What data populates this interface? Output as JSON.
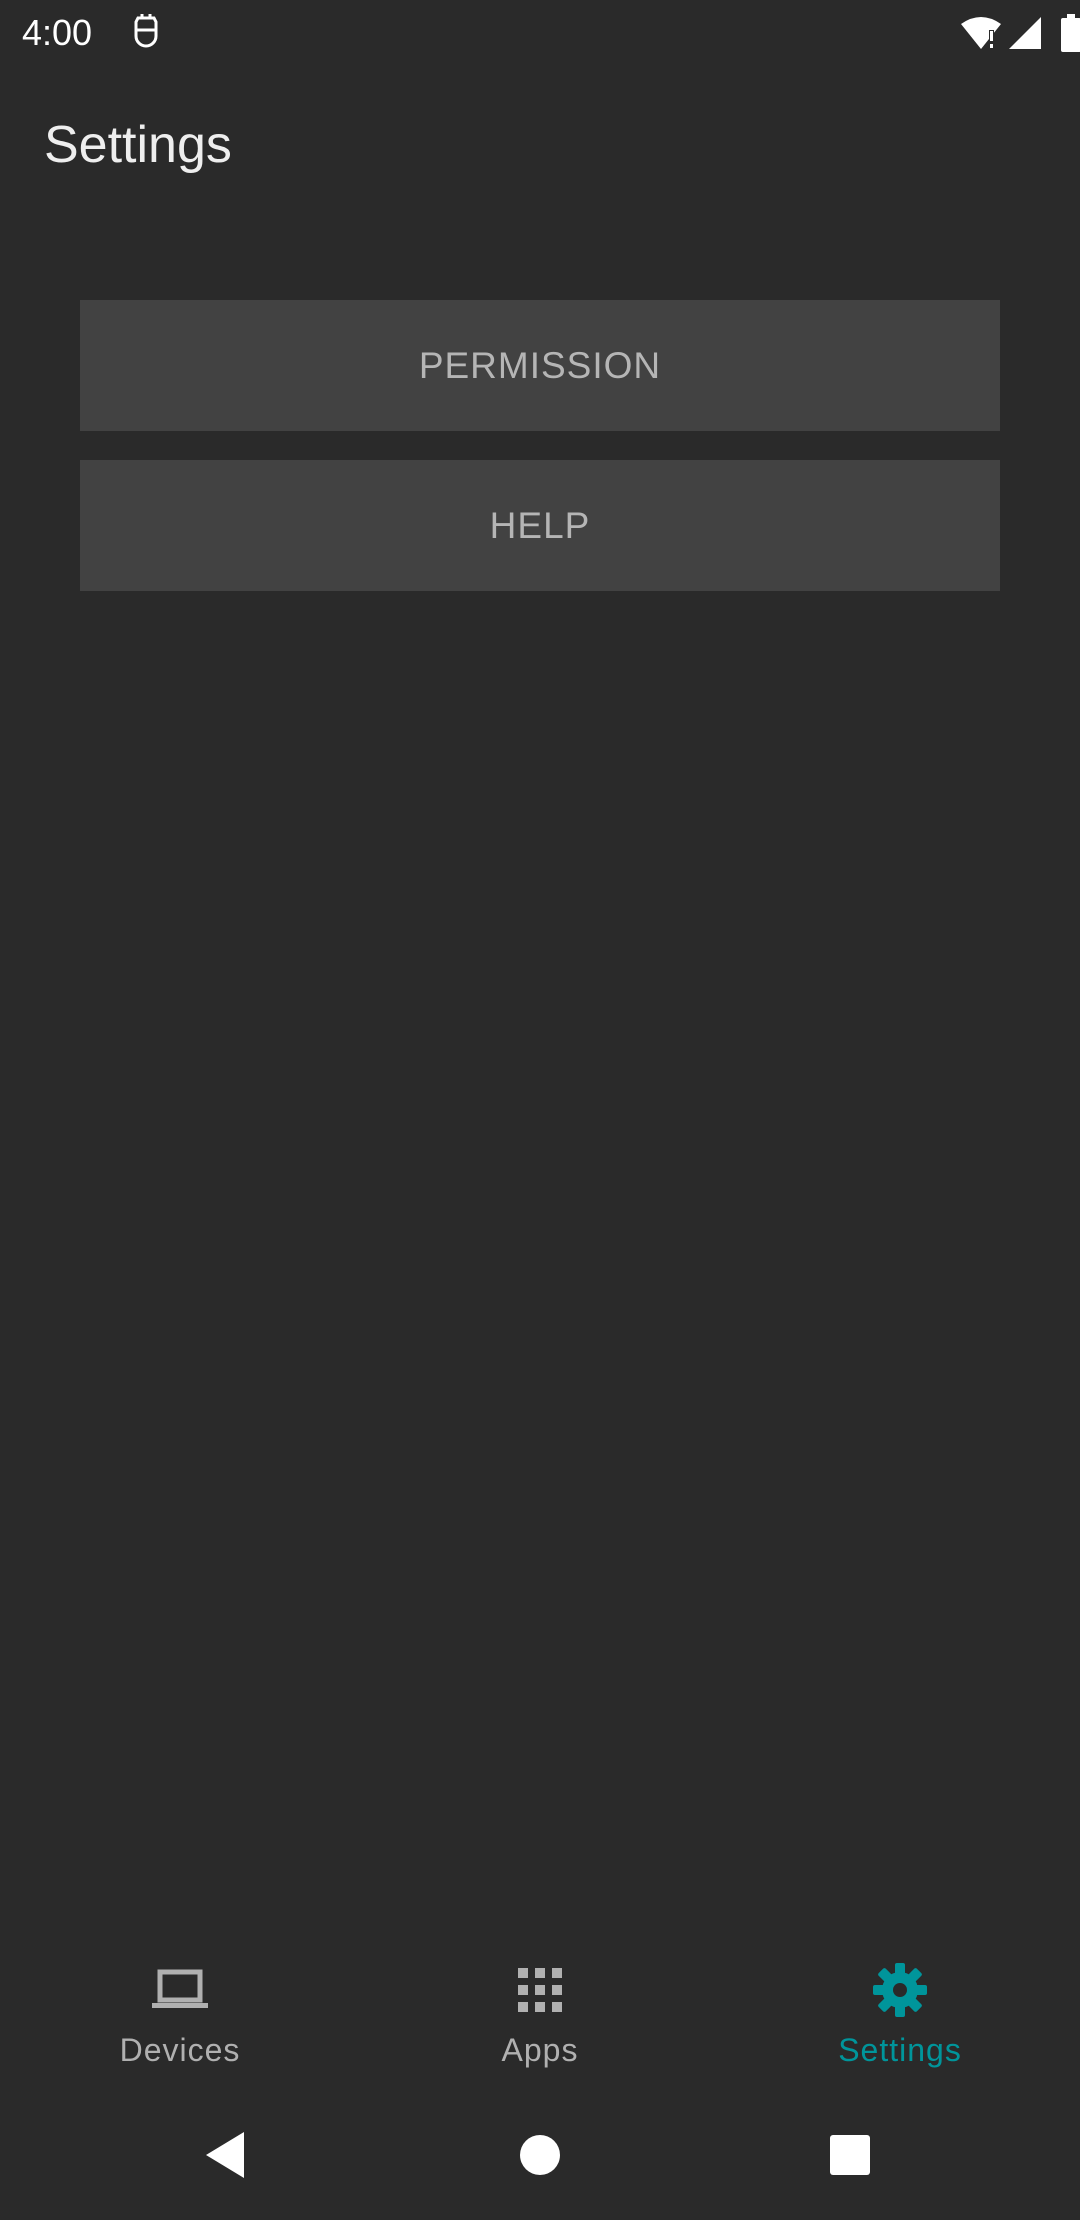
{
  "status_bar": {
    "time": "4:00",
    "icons": [
      "notification-app-icon",
      "wifi-alert-icon",
      "cell-signal-icon",
      "battery-icon"
    ]
  },
  "header": {
    "title": "Settings"
  },
  "main": {
    "buttons": [
      {
        "label": "PERMISSION"
      },
      {
        "label": "HELP"
      }
    ]
  },
  "bottom_nav": {
    "items": [
      {
        "label": "Devices",
        "icon": "laptop-icon",
        "selected": false
      },
      {
        "label": "Apps",
        "icon": "grid-icon",
        "selected": false
      },
      {
        "label": "Settings",
        "icon": "gear-icon",
        "selected": true
      }
    ]
  },
  "system_nav": {
    "icons": [
      "back-icon",
      "home-icon",
      "recents-icon"
    ]
  },
  "colors": {
    "background": "#2a2a2a",
    "button_background": "#424242",
    "accent": "#00959b",
    "inactive": "#b0b0b0"
  }
}
